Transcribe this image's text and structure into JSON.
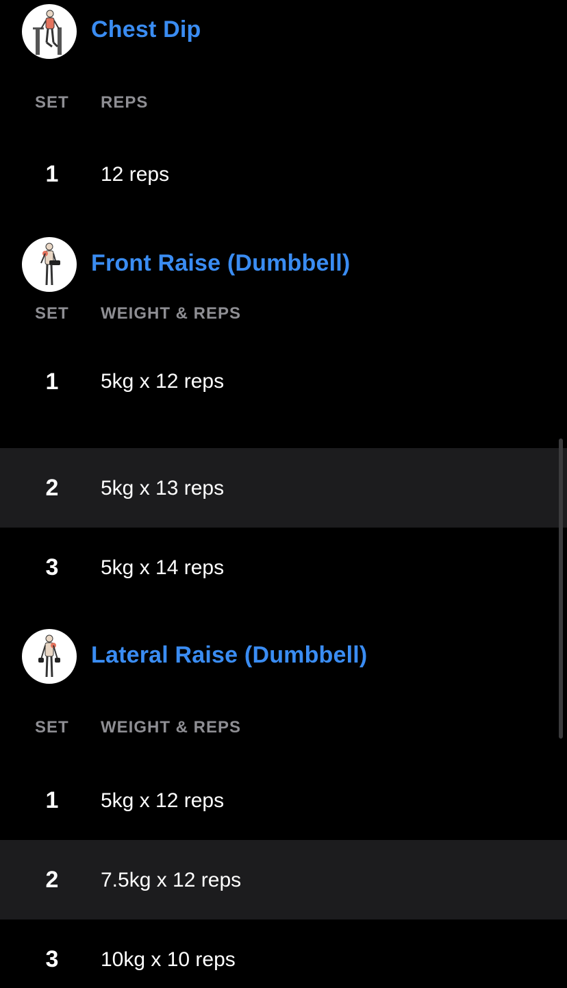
{
  "exercises": [
    {
      "title": "Chest Dip",
      "icon": "chest-dip-figure-icon",
      "columns": {
        "set": "SET",
        "value": "REPS"
      },
      "sets": [
        {
          "num": "1",
          "value": "12 reps"
        }
      ]
    },
    {
      "title": "Front Raise (Dumbbell)",
      "icon": "front-raise-figure-icon",
      "columns": {
        "set": "SET",
        "value": "WEIGHT & REPS"
      },
      "sets": [
        {
          "num": "1",
          "value": "5kg x 12 reps"
        },
        {
          "num": "2",
          "value": "5kg x 13 reps"
        },
        {
          "num": "3",
          "value": "5kg x 14 reps"
        }
      ]
    },
    {
      "title": "Lateral Raise (Dumbbell)",
      "icon": "lateral-raise-figure-icon",
      "columns": {
        "set": "SET",
        "value": "WEIGHT & REPS"
      },
      "sets": [
        {
          "num": "1",
          "value": "5kg x 12 reps"
        },
        {
          "num": "2",
          "value": "7.5kg x 12 reps"
        },
        {
          "num": "3",
          "value": "10kg x 10 reps"
        }
      ]
    }
  ],
  "colors": {
    "background": "#000000",
    "title_accent": "#3a8cf2",
    "column_header": "#8e8e93",
    "alt_row": "#1c1c1e",
    "text": "#ffffff"
  }
}
